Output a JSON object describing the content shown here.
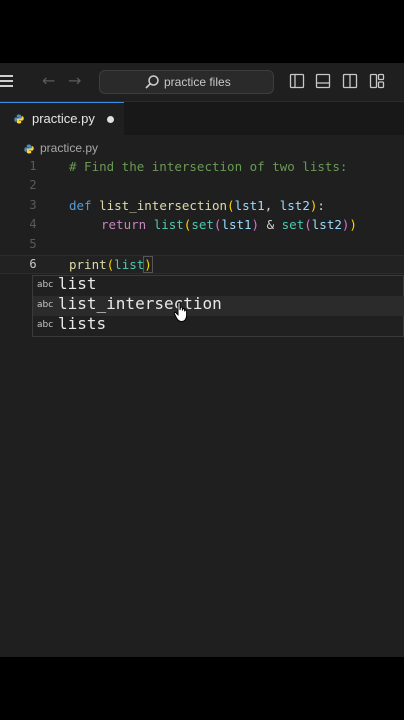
{
  "titlebar": {
    "search_placeholder": "practice files"
  },
  "tabs": [
    {
      "label": "practice.py",
      "dirty": true
    }
  ],
  "breadcrumb": {
    "file": "practice.py"
  },
  "editor": {
    "current_line": 6,
    "lines": [
      {
        "num": "1",
        "text": "# Find the intersection of two lists:"
      },
      {
        "num": "2",
        "text": ""
      },
      {
        "num": "3",
        "text": "def list_intersection(lst1, lst2):"
      },
      {
        "num": "4",
        "text": "    return list(set(lst1) & set(lst2))"
      },
      {
        "num": "5",
        "text": ""
      },
      {
        "num": "6",
        "text": "print(list)"
      }
    ]
  },
  "suggestions": [
    {
      "kind": "abc",
      "label": "list"
    },
    {
      "kind": "abc",
      "label": "list_intersection"
    },
    {
      "kind": "abc",
      "label": "lists"
    }
  ],
  "colors": {
    "accent": "#3a8ee6",
    "editor_bg": "#1f1f1f",
    "python_blue": "#4b8bbe",
    "python_yellow": "#ffd43b"
  }
}
